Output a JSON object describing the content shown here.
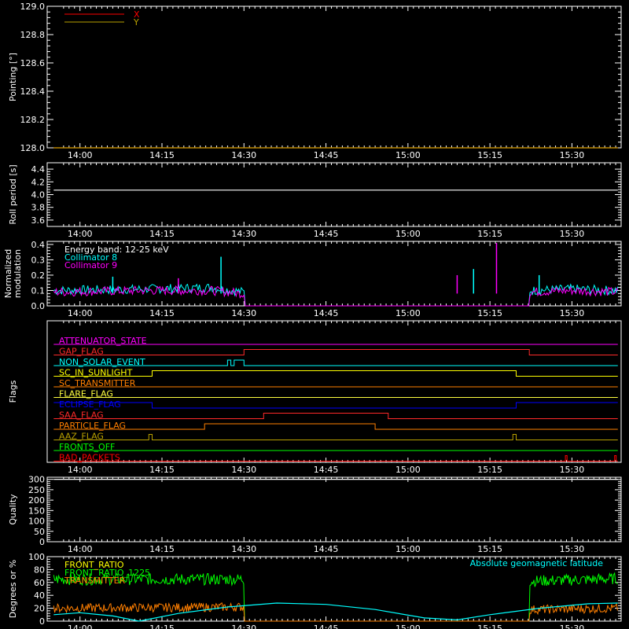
{
  "time_axis": {
    "xlim": [
      13.9,
      15.65
    ],
    "ticks": [
      14.0,
      14.25,
      14.5,
      14.75,
      15.0,
      15.25,
      15.5
    ],
    "tick_labels": [
      "14:00",
      "14:15",
      "14:30",
      "14:45",
      "15:00",
      "15:15",
      "15:30"
    ]
  },
  "chart_data": [
    {
      "type": "line",
      "ylabel": "Pointing [°]",
      "ylim": [
        128.0,
        129.0
      ],
      "yticks": [
        128.0,
        128.2,
        128.4,
        128.6,
        128.8,
        129.0
      ],
      "ytick_labels": [
        "128.0",
        "128.2",
        "128.4",
        "128.6",
        "128.8",
        "129.0"
      ],
      "legend": {
        "placement": "top-left",
        "entries": [
          {
            "label": "X",
            "color": "#ff0000"
          },
          {
            "label": "Y",
            "color": "#b8a000"
          }
        ]
      },
      "series": [
        {
          "name": "X",
          "color": "#ff0000",
          "x": [
            13.92,
            15.64
          ],
          "values": [
            128.0,
            128.0
          ]
        },
        {
          "name": "Y",
          "color": "#b8a000",
          "x": [
            13.92,
            15.64
          ],
          "values": [
            128.0,
            128.0
          ]
        }
      ]
    },
    {
      "type": "line",
      "ylabel": "Roll period [s]",
      "ylim": [
        3.5,
        4.5
      ],
      "yticks": [
        3.6,
        3.8,
        4.0,
        4.2,
        4.4
      ],
      "ytick_labels": [
        "3.6",
        "3.8",
        "4.0",
        "4.2",
        "4.4"
      ],
      "series": [
        {
          "color": "#ffffff",
          "x": [
            13.92,
            15.64
          ],
          "values": [
            4.07,
            4.07
          ]
        }
      ]
    },
    {
      "type": "line",
      "ylabel_lines": [
        "Normalized",
        "modulation"
      ],
      "ylim": [
        0.0,
        0.42
      ],
      "yticks": [
        0.0,
        0.1,
        0.2,
        0.3,
        0.4
      ],
      "ytick_labels": [
        "0.0",
        "0.1",
        "0.2",
        "0.3",
        "0.4"
      ],
      "legend": {
        "placement": "top-left",
        "entries": [
          {
            "label": "Energy band: 12-25 keV",
            "color": "#ffffff"
          },
          {
            "label": "Collimator 8",
            "color": "#00ffff"
          },
          {
            "label": "Collimator 9",
            "color": "#ff00ff"
          }
        ]
      },
      "series": [
        {
          "name": "Collimator 8",
          "color": "#00ffff",
          "x": [
            13.92,
            14.2,
            14.4,
            14.5,
            14.5,
            15.37,
            15.37,
            15.5,
            15.64
          ],
          "values": [
            0.1,
            0.11,
            0.12,
            0.09,
            0.0,
            0.0,
            0.1,
            0.11,
            0.1
          ],
          "spikes": [
            [
              14.1,
              0.19
            ],
            [
              14.43,
              0.32
            ],
            [
              15.2,
              0.24
            ],
            [
              15.4,
              0.2
            ]
          ]
        },
        {
          "name": "Collimator 9",
          "color": "#ff00ff",
          "x": [
            13.92,
            14.2,
            14.4,
            14.5,
            14.5,
            15.37,
            15.37,
            15.5,
            15.64
          ],
          "values": [
            0.09,
            0.1,
            0.1,
            0.08,
            0.0,
            0.0,
            0.09,
            0.1,
            0.09
          ],
          "spikes": [
            [
              14.3,
              0.18
            ],
            [
              15.27,
              0.41
            ],
            [
              15.15,
              0.2
            ]
          ]
        }
      ]
    },
    {
      "type": "line",
      "ylabel": "Flags",
      "flags": [
        {
          "label": "ATTENUATOR_STATE",
          "color": "#ff00ff",
          "segments": [
            [
              13.92,
              0
            ],
            [
              15.64,
              0
            ]
          ]
        },
        {
          "label": "GAP_FLAG",
          "color": "#ff2a2a",
          "segments": [
            [
              13.92,
              0
            ],
            [
              14.5,
              0
            ],
            [
              14.5,
              1
            ],
            [
              15.37,
              1
            ],
            [
              15.37,
              0
            ],
            [
              15.64,
              0
            ]
          ]
        },
        {
          "label": "NON_SOLAR_EVENT",
          "color": "#00ffff",
          "segments": [
            [
              13.92,
              0
            ],
            [
              14.45,
              0
            ],
            [
              14.45,
              1
            ],
            [
              14.46,
              1
            ],
            [
              14.46,
              0
            ],
            [
              14.47,
              0
            ],
            [
              14.47,
              1
            ],
            [
              14.5,
              1
            ],
            [
              14.5,
              0
            ],
            [
              15.64,
              0
            ]
          ]
        },
        {
          "label": "SC_IN_SUNLIGHT",
          "color": "#ffff00",
          "segments": [
            [
              13.92,
              0
            ],
            [
              14.22,
              0
            ],
            [
              14.22,
              1
            ],
            [
              15.33,
              1
            ],
            [
              15.33,
              0
            ],
            [
              15.64,
              0
            ]
          ]
        },
        {
          "label": "SC_TRANSMITTER",
          "color": "#ff7f00",
          "segments": [
            [
              13.92,
              0
            ],
            [
              15.64,
              0
            ]
          ]
        },
        {
          "label": "FLARE_FLAG",
          "color": "#ffff40",
          "segments": [
            [
              13.92,
              0
            ],
            [
              15.64,
              0
            ]
          ]
        },
        {
          "label": "ECLIPSE_FLAG",
          "color": "#0000ff",
          "segments": [
            [
              13.92,
              1
            ],
            [
              14.22,
              1
            ],
            [
              14.22,
              0
            ],
            [
              15.33,
              0
            ],
            [
              15.33,
              1
            ],
            [
              15.64,
              1
            ]
          ]
        },
        {
          "label": "SAA_FLAG",
          "color": "#ff2a2a",
          "segments": [
            [
              13.92,
              0
            ],
            [
              14.56,
              0
            ],
            [
              14.56,
              1
            ],
            [
              14.94,
              1
            ],
            [
              14.94,
              0
            ],
            [
              15.64,
              0
            ]
          ]
        },
        {
          "label": "PARTICLE_FLAG",
          "color": "#ff7f00",
          "segments": [
            [
              13.92,
              0
            ],
            [
              14.38,
              0
            ],
            [
              14.38,
              1
            ],
            [
              14.9,
              1
            ],
            [
              14.9,
              0
            ],
            [
              15.64,
              0
            ]
          ]
        },
        {
          "label": "AAZ_FLAG",
          "color": "#b8a000",
          "segments": [
            [
              13.92,
              0
            ],
            [
              14.21,
              0
            ],
            [
              14.21,
              1
            ],
            [
              14.22,
              1
            ],
            [
              14.22,
              0
            ],
            [
              15.32,
              0
            ],
            [
              15.32,
              1
            ],
            [
              15.33,
              1
            ],
            [
              15.33,
              0
            ],
            [
              15.64,
              0
            ]
          ]
        },
        {
          "label": "FRONTS_OFF",
          "color": "#00ff00",
          "segments": [
            [
              13.92,
              0
            ],
            [
              15.64,
              0
            ]
          ]
        },
        {
          "label": "BAD_PACKETS",
          "color": "#ff0000",
          "segments": [
            [
              13.92,
              0
            ],
            [
              15.48,
              0
            ],
            [
              15.48,
              1
            ],
            [
              15.485,
              1
            ],
            [
              15.485,
              0
            ],
            [
              15.63,
              0
            ],
            [
              15.63,
              1
            ],
            [
              15.635,
              1
            ],
            [
              15.635,
              0
            ],
            [
              15.64,
              0
            ]
          ]
        }
      ]
    },
    {
      "type": "line",
      "ylabel": "Quality",
      "ylim": [
        0,
        310
      ],
      "yticks": [
        0,
        50,
        100,
        150,
        200,
        250,
        300
      ],
      "ytick_labels": [
        "0",
        "50",
        "100",
        "150",
        "200",
        "250",
        "300"
      ],
      "series": [
        {
          "color": "#ffffff",
          "x": [
            13.92,
            15.64
          ],
          "values": [
            300,
            300
          ]
        }
      ]
    },
    {
      "type": "line",
      "ylabel": "Degrees or %",
      "ylim": [
        0,
        100
      ],
      "yticks": [
        0,
        20,
        40,
        60,
        80,
        100
      ],
      "ytick_labels": [
        "0",
        "20",
        "40",
        "60",
        "80",
        "100"
      ],
      "legend": {
        "placement": "top-left",
        "entries": [
          {
            "label": "FRONT_RATIO",
            "color": "#ffff00"
          },
          {
            "label": "FRONT_RATIO_1225",
            "color": "#00ff00"
          },
          {
            "label": "TRANSMITTER",
            "color": "#ff7f00"
          }
        ]
      },
      "annotation": {
        "text": "Absolute geomagnetic latitude",
        "color": "#00ffff"
      },
      "series": [
        {
          "name": "FRONT_RATIO_1225",
          "color": "#00ff00",
          "x": [
            13.92,
            14.5,
            14.5,
            15.37,
            15.37,
            15.64
          ],
          "values": [
            65,
            65,
            0,
            0,
            62,
            66
          ]
        },
        {
          "name": "TRANSMITTER",
          "color": "#ff7f00",
          "x": [
            13.92,
            14.5,
            14.5,
            15.37,
            15.37,
            15.64
          ],
          "values": [
            20,
            22,
            0,
            0,
            18,
            20
          ]
        },
        {
          "name": "Absolute geomagnetic latitude",
          "color": "#00ffff",
          "x": [
            13.92,
            14.0,
            14.1,
            14.18,
            14.3,
            14.45,
            14.6,
            14.75,
            14.9,
            15.05,
            15.15,
            15.25,
            15.4,
            15.55,
            15.64
          ],
          "values": [
            10,
            13,
            8,
            0,
            12,
            22,
            28,
            26,
            18,
            5,
            2,
            10,
            20,
            27,
            28
          ]
        }
      ]
    }
  ]
}
